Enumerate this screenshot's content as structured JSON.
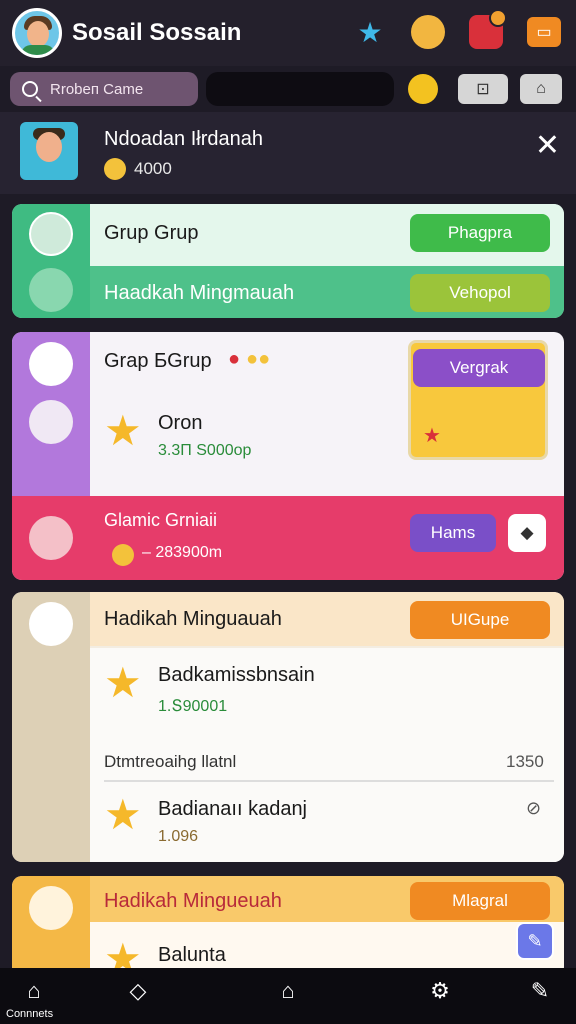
{
  "header": {
    "title": "Sosail Sossain"
  },
  "search": {
    "placeholder": "Rrobeп Came"
  },
  "notice": {
    "name": "Ndoadan Iłrdanah",
    "amount": "4000",
    "close": "✕"
  },
  "cards": [
    {
      "rows": [
        {
          "title": "Grup Grup",
          "button": "Phagpra"
        },
        {
          "title": "Haadkah Mingmauah",
          "button": "Vehopol"
        }
      ]
    },
    {
      "title": "Grap ƂGrup",
      "item": {
        "name": "Oron",
        "value": "3.3Π S000op"
      },
      "yellow_button": "Vergrak",
      "lower": {
        "title": "Glamic Grniaii",
        "value": "– 283900m",
        "button": "Hams"
      }
    },
    {
      "title": "Hadikah Minguauah",
      "button": "UIGupe",
      "items": [
        {
          "name": "Badkamissbnsain",
          "value": "1.Տ90001"
        },
        {
          "name": "Badianaıı kadanj",
          "value": "1.096"
        }
      ],
      "row_label": "Dtmtreoaihg llatnl",
      "row_value": "1350"
    },
    {
      "title": "Hadikah Mingueuah",
      "button": "Mlagral",
      "item": {
        "name": "Balunta"
      }
    }
  ],
  "nav": {
    "label": "Connnets"
  },
  "colors": {
    "green": "#3fbb82",
    "purple": "#b278dc",
    "pink": "#e63c6a",
    "orange": "#f08a22"
  }
}
